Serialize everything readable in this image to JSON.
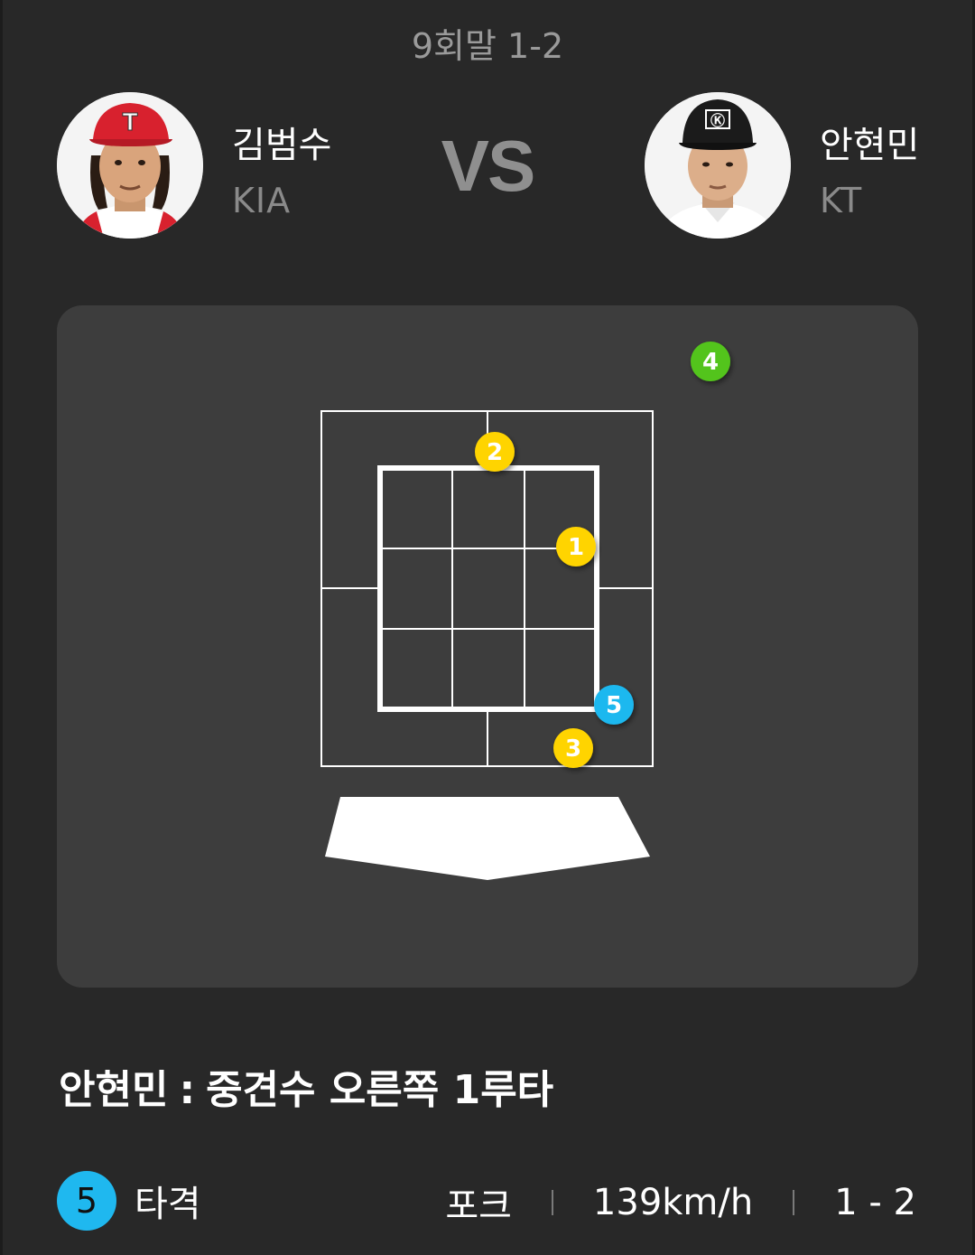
{
  "header": {
    "inning": "9회말 1-2",
    "vs_label": "VS"
  },
  "players": {
    "left": {
      "name": "김범수",
      "team": "KIA",
      "cap_letter": "T",
      "cap_color": "#d8212e"
    },
    "right": {
      "name": "안현민",
      "team": "KT",
      "cap_letter": "Ⓚ",
      "cap_color": "#1b1b1b"
    }
  },
  "pitches": [
    {
      "number": "1",
      "color": "#ffd400"
    },
    {
      "number": "2",
      "color": "#ffd400"
    },
    {
      "number": "3",
      "color": "#ffd400"
    },
    {
      "number": "4",
      "color": "#52c41a"
    },
    {
      "number": "5",
      "color": "#1fb8ef"
    }
  ],
  "result": {
    "batter": "안현민",
    "separator": ":",
    "description": "중견수 오른쪽 1루타"
  },
  "last_pitch": {
    "number": "5",
    "result": "타격",
    "pitch_type": "포크",
    "speed": "139km/h",
    "count": "1 - 2",
    "badge_color": "#1fb8ef"
  },
  "icons": {
    "left_avatar": "player-photo-kia",
    "right_avatar": "player-photo-kt",
    "plate": "home-plate-icon"
  }
}
